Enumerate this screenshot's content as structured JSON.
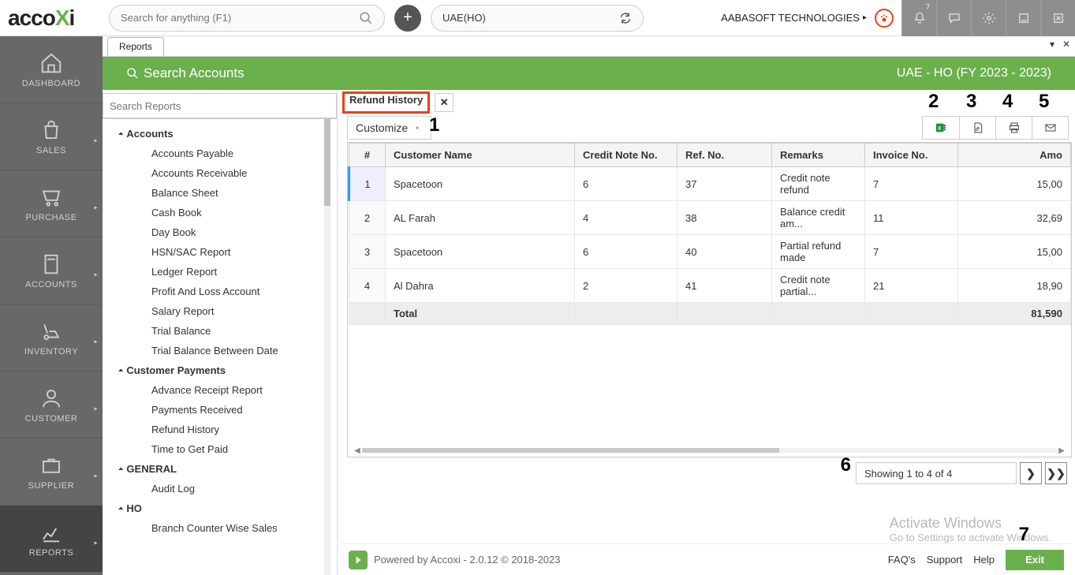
{
  "app": {
    "logo_a": "acco",
    "logo_b": "X",
    "logo_c": "i"
  },
  "header": {
    "search_placeholder": "Search for anything (F1)",
    "branch": "UAE(HO)",
    "company": "AABASOFT TECHNOLOGIES",
    "bell_badge": "7"
  },
  "sidebar": {
    "items": [
      {
        "label": "DASHBOARD",
        "icon": "home"
      },
      {
        "label": "SALES",
        "icon": "bag",
        "caret": true
      },
      {
        "label": "PURCHASE",
        "icon": "cart",
        "caret": true
      },
      {
        "label": "ACCOUNTS",
        "icon": "calc",
        "caret": true
      },
      {
        "label": "INVENTORY",
        "icon": "dolly",
        "caret": true
      },
      {
        "label": "CUSTOMER",
        "icon": "user",
        "caret": true
      },
      {
        "label": "SUPPLIER",
        "icon": "case",
        "caret": true
      },
      {
        "label": "REPORTS",
        "icon": "chart",
        "caret": true
      }
    ]
  },
  "tabs": {
    "main": "Reports"
  },
  "greenbar": {
    "search": "Search Accounts",
    "fy": "UAE - HO (FY 2023 - 2023)"
  },
  "reportSearchPlaceholder": "Search Reports",
  "tree": {
    "g1": "Accounts",
    "g1_items": [
      "Accounts Payable",
      "Accounts Receivable",
      "Balance Sheet",
      "Cash Book",
      "Day Book",
      "HSN/SAC Report",
      "Ledger Report",
      "Profit And Loss Account",
      "Salary Report",
      "Trial Balance",
      "Trial Balance Between Date"
    ],
    "g2": "Customer Payments",
    "g2_items": [
      "Advance Receipt Report",
      "Payments Received",
      "Refund History",
      "Time to Get Paid"
    ],
    "g3": "GENERAL",
    "g3_items": [
      "Audit Log"
    ],
    "g4": "HO",
    "g4_items": [
      "Branch Counter Wise Sales"
    ]
  },
  "rtab": "Refund History",
  "customize": "Customize",
  "annot": {
    "a1": "1",
    "a2": "2",
    "a3": "3",
    "a4": "4",
    "a5": "5",
    "a6": "6",
    "a7": "7"
  },
  "table": {
    "headers": {
      "idx": "#",
      "cust": "Customer Name",
      "cn": "Credit Note No.",
      "ref": "Ref. No.",
      "rem": "Remarks",
      "inv": "Invoice No.",
      "amt": "Amo"
    },
    "rows": [
      {
        "idx": "1",
        "cust": "Spacetoon",
        "cn": "6",
        "ref": "37",
        "rem": "Credit note refund",
        "inv": "7",
        "amt": "15,00"
      },
      {
        "idx": "2",
        "cust": "AL Farah",
        "cn": "4",
        "ref": "38",
        "rem": "Balance credit am...",
        "inv": "11",
        "amt": "32,69"
      },
      {
        "idx": "3",
        "cust": "Spacetoon",
        "cn": "6",
        "ref": "40",
        "rem": "Partial refund made",
        "inv": "7",
        "amt": "15,00"
      },
      {
        "idx": "4",
        "cust": "Al Dahra",
        "cn": "2",
        "ref": "41",
        "rem": "Credit  note  partial...",
        "inv": "21",
        "amt": "18,90"
      }
    ],
    "total_label": "Total",
    "total_amt": "81,590"
  },
  "pager": {
    "info": "Showing 1 to 4 of 4"
  },
  "watermark": {
    "l1": "Activate Windows",
    "l2": "Go to Settings to activate Windows."
  },
  "footer": {
    "powered": "Powered by Accoxi - 2.0.12 © 2018-2023",
    "faq": "FAQ's",
    "support": "Support",
    "help": "Help",
    "exit": "Exit"
  }
}
